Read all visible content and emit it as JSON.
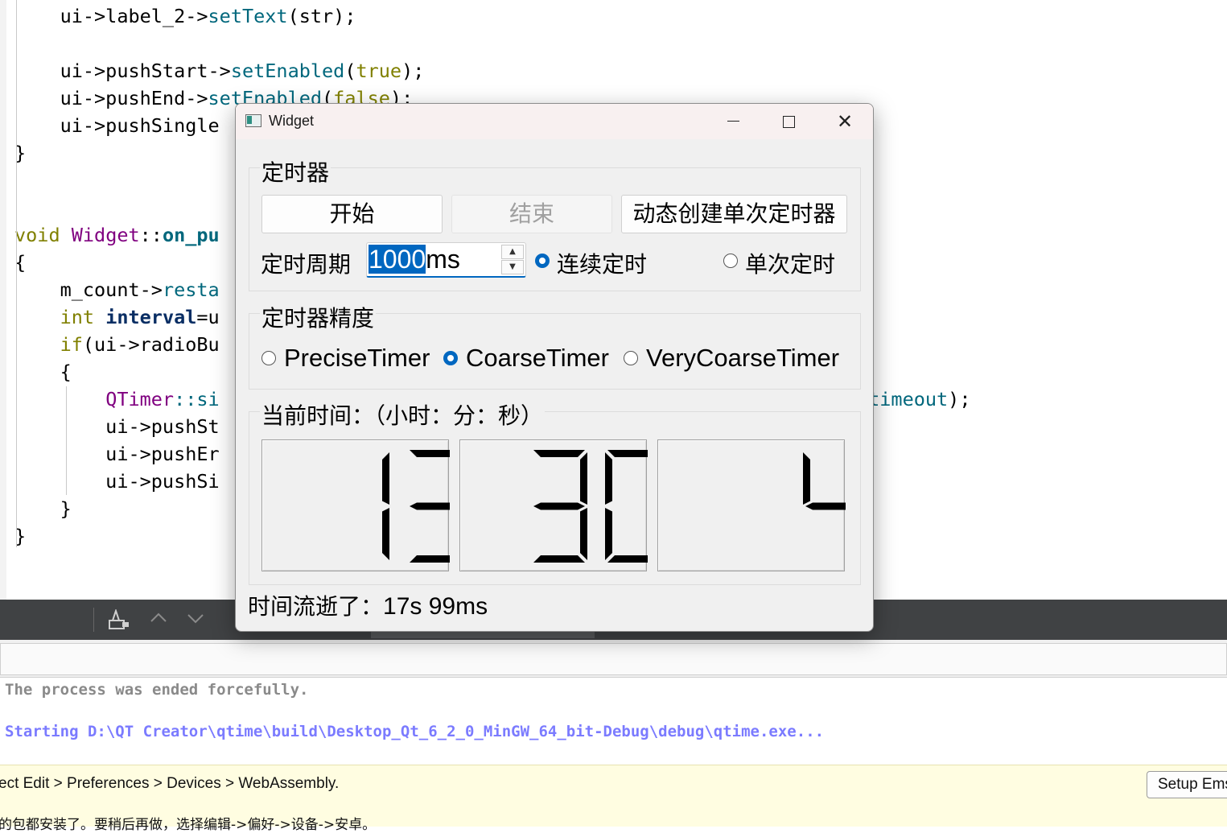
{
  "editor": {
    "lines": [
      {
        "parts": [
          [
            "    ui->label_2->",
            ""
          ],
          [
            "setText",
            "c-fn"
          ],
          [
            "(str);",
            ""
          ]
        ]
      },
      {
        "parts": [
          [
            "",
            ""
          ]
        ]
      },
      {
        "parts": [
          [
            "    ui->pushStart->",
            ""
          ],
          [
            "setEnabled",
            "c-fn"
          ],
          [
            "(",
            ""
          ],
          [
            "true",
            "c-kw"
          ],
          [
            ");",
            ""
          ]
        ]
      },
      {
        "parts": [
          [
            "    ui->pushEnd->",
            ""
          ],
          [
            "setEnabled",
            "c-fn"
          ],
          [
            "(",
            ""
          ],
          [
            "false",
            "c-kw"
          ],
          [
            ");",
            ""
          ]
        ]
      },
      {
        "parts": [
          [
            "    ui->pushSingle",
            ""
          ]
        ]
      },
      {
        "parts": [
          [
            "}",
            ""
          ]
        ]
      },
      {
        "parts": [
          [
            "",
            ""
          ]
        ]
      },
      {
        "parts": [
          [
            "",
            ""
          ]
        ]
      },
      {
        "parts": [
          [
            "void",
            "c-kw"
          ],
          [
            " ",
            ""
          ],
          [
            "Widget",
            "c-type"
          ],
          [
            "::",
            ""
          ],
          [
            "on_pu",
            "c-bold"
          ]
        ]
      },
      {
        "parts": [
          [
            "{",
            ""
          ]
        ]
      },
      {
        "parts": [
          [
            "    m_count->",
            ""
          ],
          [
            "resta",
            "c-fn"
          ]
        ]
      },
      {
        "parts": [
          [
            "    ",
            ""
          ],
          [
            "int",
            "c-int"
          ],
          [
            " ",
            ""
          ],
          [
            "interval",
            "c-navy"
          ],
          [
            "=u",
            ""
          ]
        ]
      },
      {
        "parts": [
          [
            "    ",
            ""
          ],
          [
            "if",
            "c-kw"
          ],
          [
            "(ui->radioBu",
            ""
          ]
        ]
      },
      {
        "parts": [
          [
            "    {",
            ""
          ]
        ]
      },
      {
        "parts": [
          [
            "        ",
            ""
          ],
          [
            "QTimer",
            "c-type"
          ],
          [
            "::si",
            "c-fn"
          ],
          [
            "                                                 ",
            ""
          ],
          [
            "o_timer_timeout",
            "c-fn"
          ],
          [
            ");",
            ""
          ]
        ]
      },
      {
        "parts": [
          [
            "        ui->pushSt",
            ""
          ]
        ]
      },
      {
        "parts": [
          [
            "        ui->pushEr",
            ""
          ]
        ]
      },
      {
        "parts": [
          [
            "        ui->pushSi",
            ""
          ]
        ]
      },
      {
        "parts": [
          [
            "    }",
            ""
          ]
        ]
      },
      {
        "parts": [
          [
            "}",
            ""
          ]
        ]
      }
    ]
  },
  "widget": {
    "title": "Widget",
    "group_timer": {
      "title": "定时器",
      "start_label": "开始",
      "end_label": "结束",
      "dynamic_label": "动态创建单次定时器",
      "period_label": "定时周期",
      "period_value_selected": "1000",
      "period_suffix": "ms",
      "continuous_label": "连续定时",
      "continuous_checked": true,
      "single_label": "单次定时",
      "single_checked": false
    },
    "group_precision": {
      "title": "定时器精度",
      "options": [
        {
          "label": "PreciseTimer",
          "checked": false
        },
        {
          "label": "CoarseTimer",
          "checked": true
        },
        {
          "label": "VeryCoarseTimer",
          "checked": false
        }
      ]
    },
    "group_time": {
      "title": "当前时间：（小时：分：秒）",
      "hours": "13",
      "minutes": "30",
      "seconds": "4"
    },
    "elapsed_prefix": "时间流逝了：",
    "elapsed_value": "17s 99ms"
  },
  "output": {
    "line1": "The process was ended forcefully.",
    "line2": "Starting D:\\QT Creator\\qtime\\build\\Desktop_Qt_6_2_0_MinGW_64_bit-Debug\\debug\\qtime.exe..."
  },
  "infobar": {
    "message": "ect Edit > Preferences > Devices > WebAssembly.",
    "setup_label": "Setup Ems",
    "message2": "的包都安装了。要稍后再做，选择编辑->偏好->设备->安卓。"
  },
  "colors": {
    "accent": "#0067c0",
    "lcd_segment": "#000000",
    "toolbar": "#404244"
  }
}
